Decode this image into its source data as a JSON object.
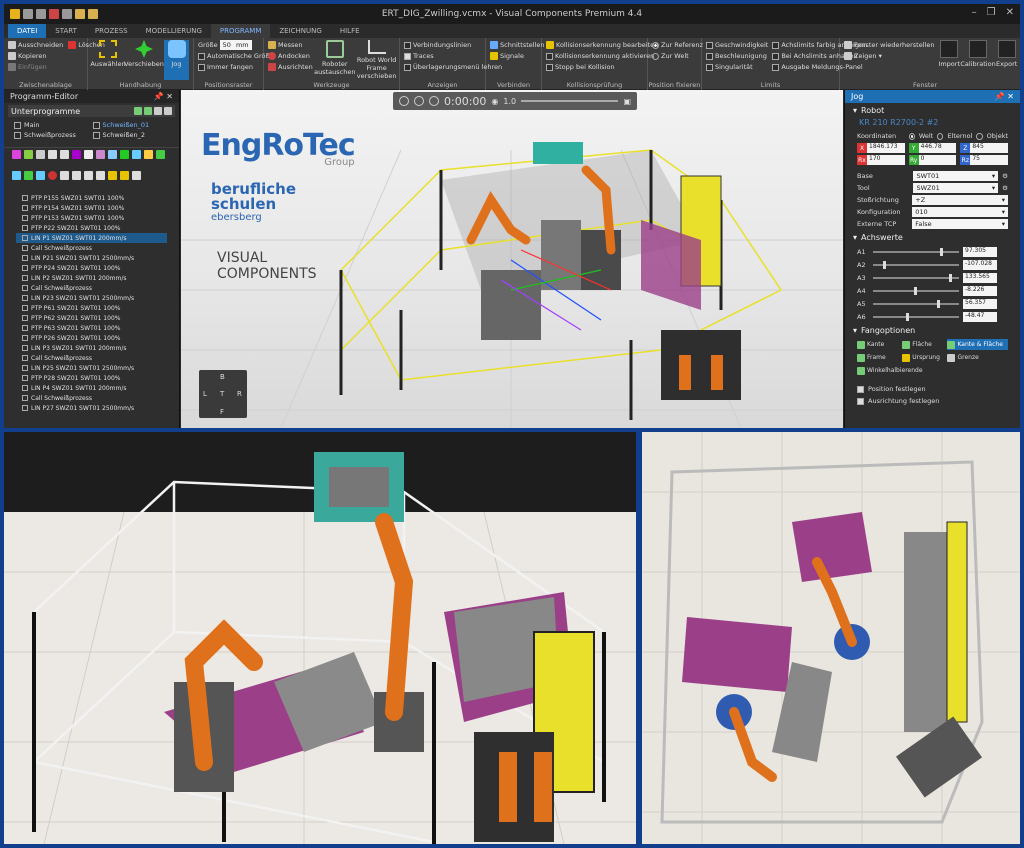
{
  "window": {
    "title": "ERT_DIG_Zwilling.vcmx - Visual Components Premium 4.4"
  },
  "menu_tabs": [
    "DATEI",
    "START",
    "PROZESS",
    "MODELLIERUNG",
    "PROGRAMM",
    "ZEICHNUNG",
    "HILFE"
  ],
  "ribbon": {
    "clipboard": {
      "cut": "Ausschneiden",
      "delete": "Löschen",
      "copy": "Kopieren",
      "paste": "Einfügen",
      "label": "Zwischenablage"
    },
    "handling": {
      "select": "Auswählen",
      "move": "Verschieben",
      "jog": "Jog",
      "label": "Handhabung"
    },
    "grid": {
      "size_label": "Größe",
      "size_value": "50",
      "unit": "mm",
      "auto_size": "Automatische Größe",
      "always_snap": "Immer fangen",
      "label": "Positionsraster"
    },
    "tools": {
      "measure": "Messen",
      "dock": "Andocken",
      "align": "Ausrichten",
      "robot_swap": "Roboter austauschen",
      "robot_world": "Robot World Frame verschieben",
      "label": "Werkzeuge"
    },
    "display": {
      "connection_lines": "Verbindungslinien",
      "traces": "Traces",
      "overlay_menu": "Überlagerungsmenü lehren",
      "label": "Anzeigen"
    },
    "connect": {
      "interfaces": "Schnittstellen",
      "signals": "Signale",
      "label": "Verbinden"
    },
    "collision": {
      "edit": "Kollisionserkennung bearbeiten",
      "activate": "Kollisionserkennung aktivieren",
      "stop": "Stopp bei Kollision",
      "label": "Kollisionsprüfung"
    },
    "position": {
      "ref": "Zur Referenz",
      "world": "Zur Welt",
      "label": "Position fixieren"
    },
    "limits": {
      "speed": "Geschwindigkeit",
      "accel": "Beschleunigung",
      "sing": "Singularität",
      "color": "Achslimits farbig anzeigen",
      "stop": "Bei Achslimits anhalten",
      "out": "Ausgabe Meldungs-Panel",
      "label": "Limits"
    },
    "window": {
      "restore": "Fenster wiederherstellen",
      "show": "Zeigen ▾",
      "import": "Import",
      "calib": "Calibration",
      "export": "Export",
      "label": "Fenster"
    }
  },
  "program_editor": {
    "title": "Programm-Editor",
    "subroutines_label": "Unterprogramme",
    "routines": [
      "Main",
      "Schweißen_01",
      "Schweißprozess",
      "Schweißen_2"
    ],
    "statements": [
      "PTP P155 SWZ01 SWT01 100%",
      "PTP P154 SWZ01 SWT01 100%",
      "PTP P153 SWZ01 SWT01 100%",
      "PTP P22 SWZ01 SWT01 100%",
      "LIN P1 SWZ01 SWT01 200mm/s",
      "Call Schweißprozess",
      "LIN P21 SWZ01 SWT01 2500mm/s",
      "PTP P24 SWZ01 SWT01 100%",
      "LIN P2 SWZ01 SWT01 200mm/s",
      "Call Schweißprozess",
      "LIN P23 SWZ01 SWT01 2500mm/s",
      "PTP P61 SWZ01 SWT01 100%",
      "PTP P62 SWZ01 SWT01 100%",
      "PTP P63 SWZ01 SWT01 100%",
      "PTP P26 SWZ01 SWT01 100%",
      "LIN P3 SWZ01 SWT01 200mm/s",
      "Call Schweißprozess",
      "LIN P25 SWZ01 SWT01 2500mm/s",
      "PTP P28 SWZ01 SWT01 100%",
      "LIN P4 SWZ01 SWT01 200mm/s",
      "Call Schweißprozess",
      "LIN P27 SWZ01 SWT01 2500mm/s"
    ]
  },
  "viewport": {
    "time": "0:00:00",
    "speed": "1.0",
    "logo_engrotec": "EngRoTec",
    "logo_engrotec_sub": "Group",
    "logo_bs_1": "berufliche",
    "logo_bs_2": "schulen",
    "logo_bs_3": "ebersberg",
    "logo_vc_1": "VISUAL",
    "logo_vc_2": "COMPONENTS",
    "nav": {
      "top": "B",
      "left": "L",
      "center": "T",
      "right": "R",
      "bottom": "F"
    }
  },
  "jog": {
    "title": "Jog",
    "robot_section": "Robot",
    "robot_name": "KR 210 R2700-2 #2",
    "coord_label": "Koordinaten",
    "coord_options": [
      "Welt",
      "Elternol",
      "Objekt"
    ],
    "coords": {
      "X": "1846.173",
      "Y": "446.78",
      "Z": "845",
      "Rx": "170",
      "Ry": "0",
      "Rz": "75"
    },
    "base_label": "Base",
    "base_value": "SWT01",
    "tool_label": "Tool",
    "tool_value": "SWZ01",
    "approach_label": "Stoßrichtung",
    "approach_value": "+Z",
    "config_label": "Konfiguration",
    "config_value": "010",
    "ext_tcp_label": "Externe TCP",
    "ext_tcp_value": "False",
    "axes_section": "Achswerte",
    "axes": [
      {
        "name": "A1",
        "value": "97.305",
        "pos": 0.78
      },
      {
        "name": "A2",
        "value": "-107.028",
        "pos": 0.12
      },
      {
        "name": "A3",
        "value": "133.565",
        "pos": 0.88
      },
      {
        "name": "A4",
        "value": "-8.226",
        "pos": 0.48
      },
      {
        "name": "A5",
        "value": "56.357",
        "pos": 0.74
      },
      {
        "name": "A6",
        "value": "-48.47",
        "pos": 0.38
      }
    ],
    "snap_section": "Fangoptionen",
    "snap": [
      "Kante",
      "Fläche",
      "Kante & Fläche",
      "Frame",
      "Ursprung",
      "Grenze",
      "Winkelhalbierende"
    ],
    "fix_pos": "Position festlegen",
    "fix_orient": "Ausrichtung festlegen"
  },
  "colors": {
    "accent": "#1f6fb5",
    "frame": "#123f8c",
    "robot": "#e0711c",
    "fence": "#e8e02a",
    "teal": "#2fb0a0",
    "magenta": "#9a3f88"
  }
}
